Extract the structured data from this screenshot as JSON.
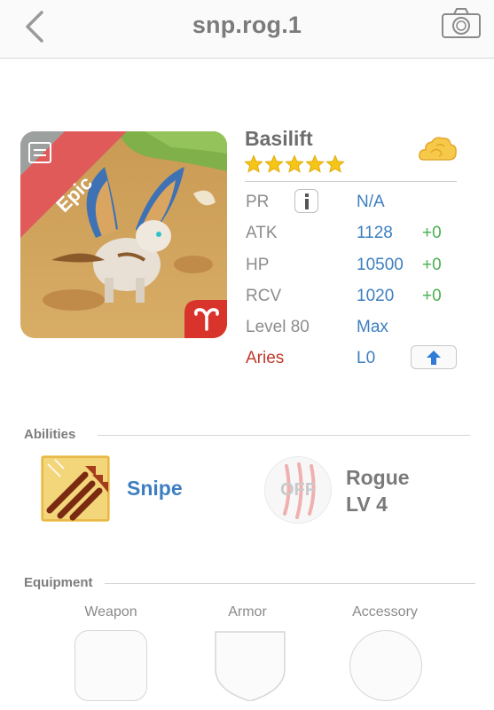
{
  "header": {
    "title": "snp.rog.1"
  },
  "monster": {
    "rarity": "Epic",
    "name": "Basilift",
    "stars": 5,
    "stats": {
      "pr_label": "PR",
      "pr_value": "N/A",
      "atk_label": "ATK",
      "atk_value": "1128",
      "atk_bonus": "+0",
      "hp_label": "HP",
      "hp_value": "10500",
      "hp_bonus": "+0",
      "rcv_label": "RCV",
      "rcv_value": "1020",
      "rcv_bonus": "+0",
      "level_label": "Level 80",
      "level_value": "Max",
      "sign_label": "Aries",
      "sign_value": "L0"
    }
  },
  "abilities": {
    "section_title": "Abilities",
    "ability_name": "Snipe",
    "class_status": "OFF",
    "class_name": "Rogue",
    "class_level": "LV 4"
  },
  "equipment": {
    "section_title": "Equipment",
    "slots": [
      "Weapon",
      "Armor",
      "Accessory"
    ]
  },
  "colors": {
    "accent_blue": "#3d7fc0",
    "bonus_green": "#4caf50",
    "sign_red": "#c0392b",
    "epic_ribbon": "#e05a5a",
    "star_gold": "#f5c518"
  },
  "icons": [
    "back-chevron-icon",
    "camera-icon",
    "info-icon",
    "cloud-icon",
    "aries-icon",
    "upgrade-arrow-icon",
    "snipe-arrows-icon",
    "claw-icon"
  ]
}
